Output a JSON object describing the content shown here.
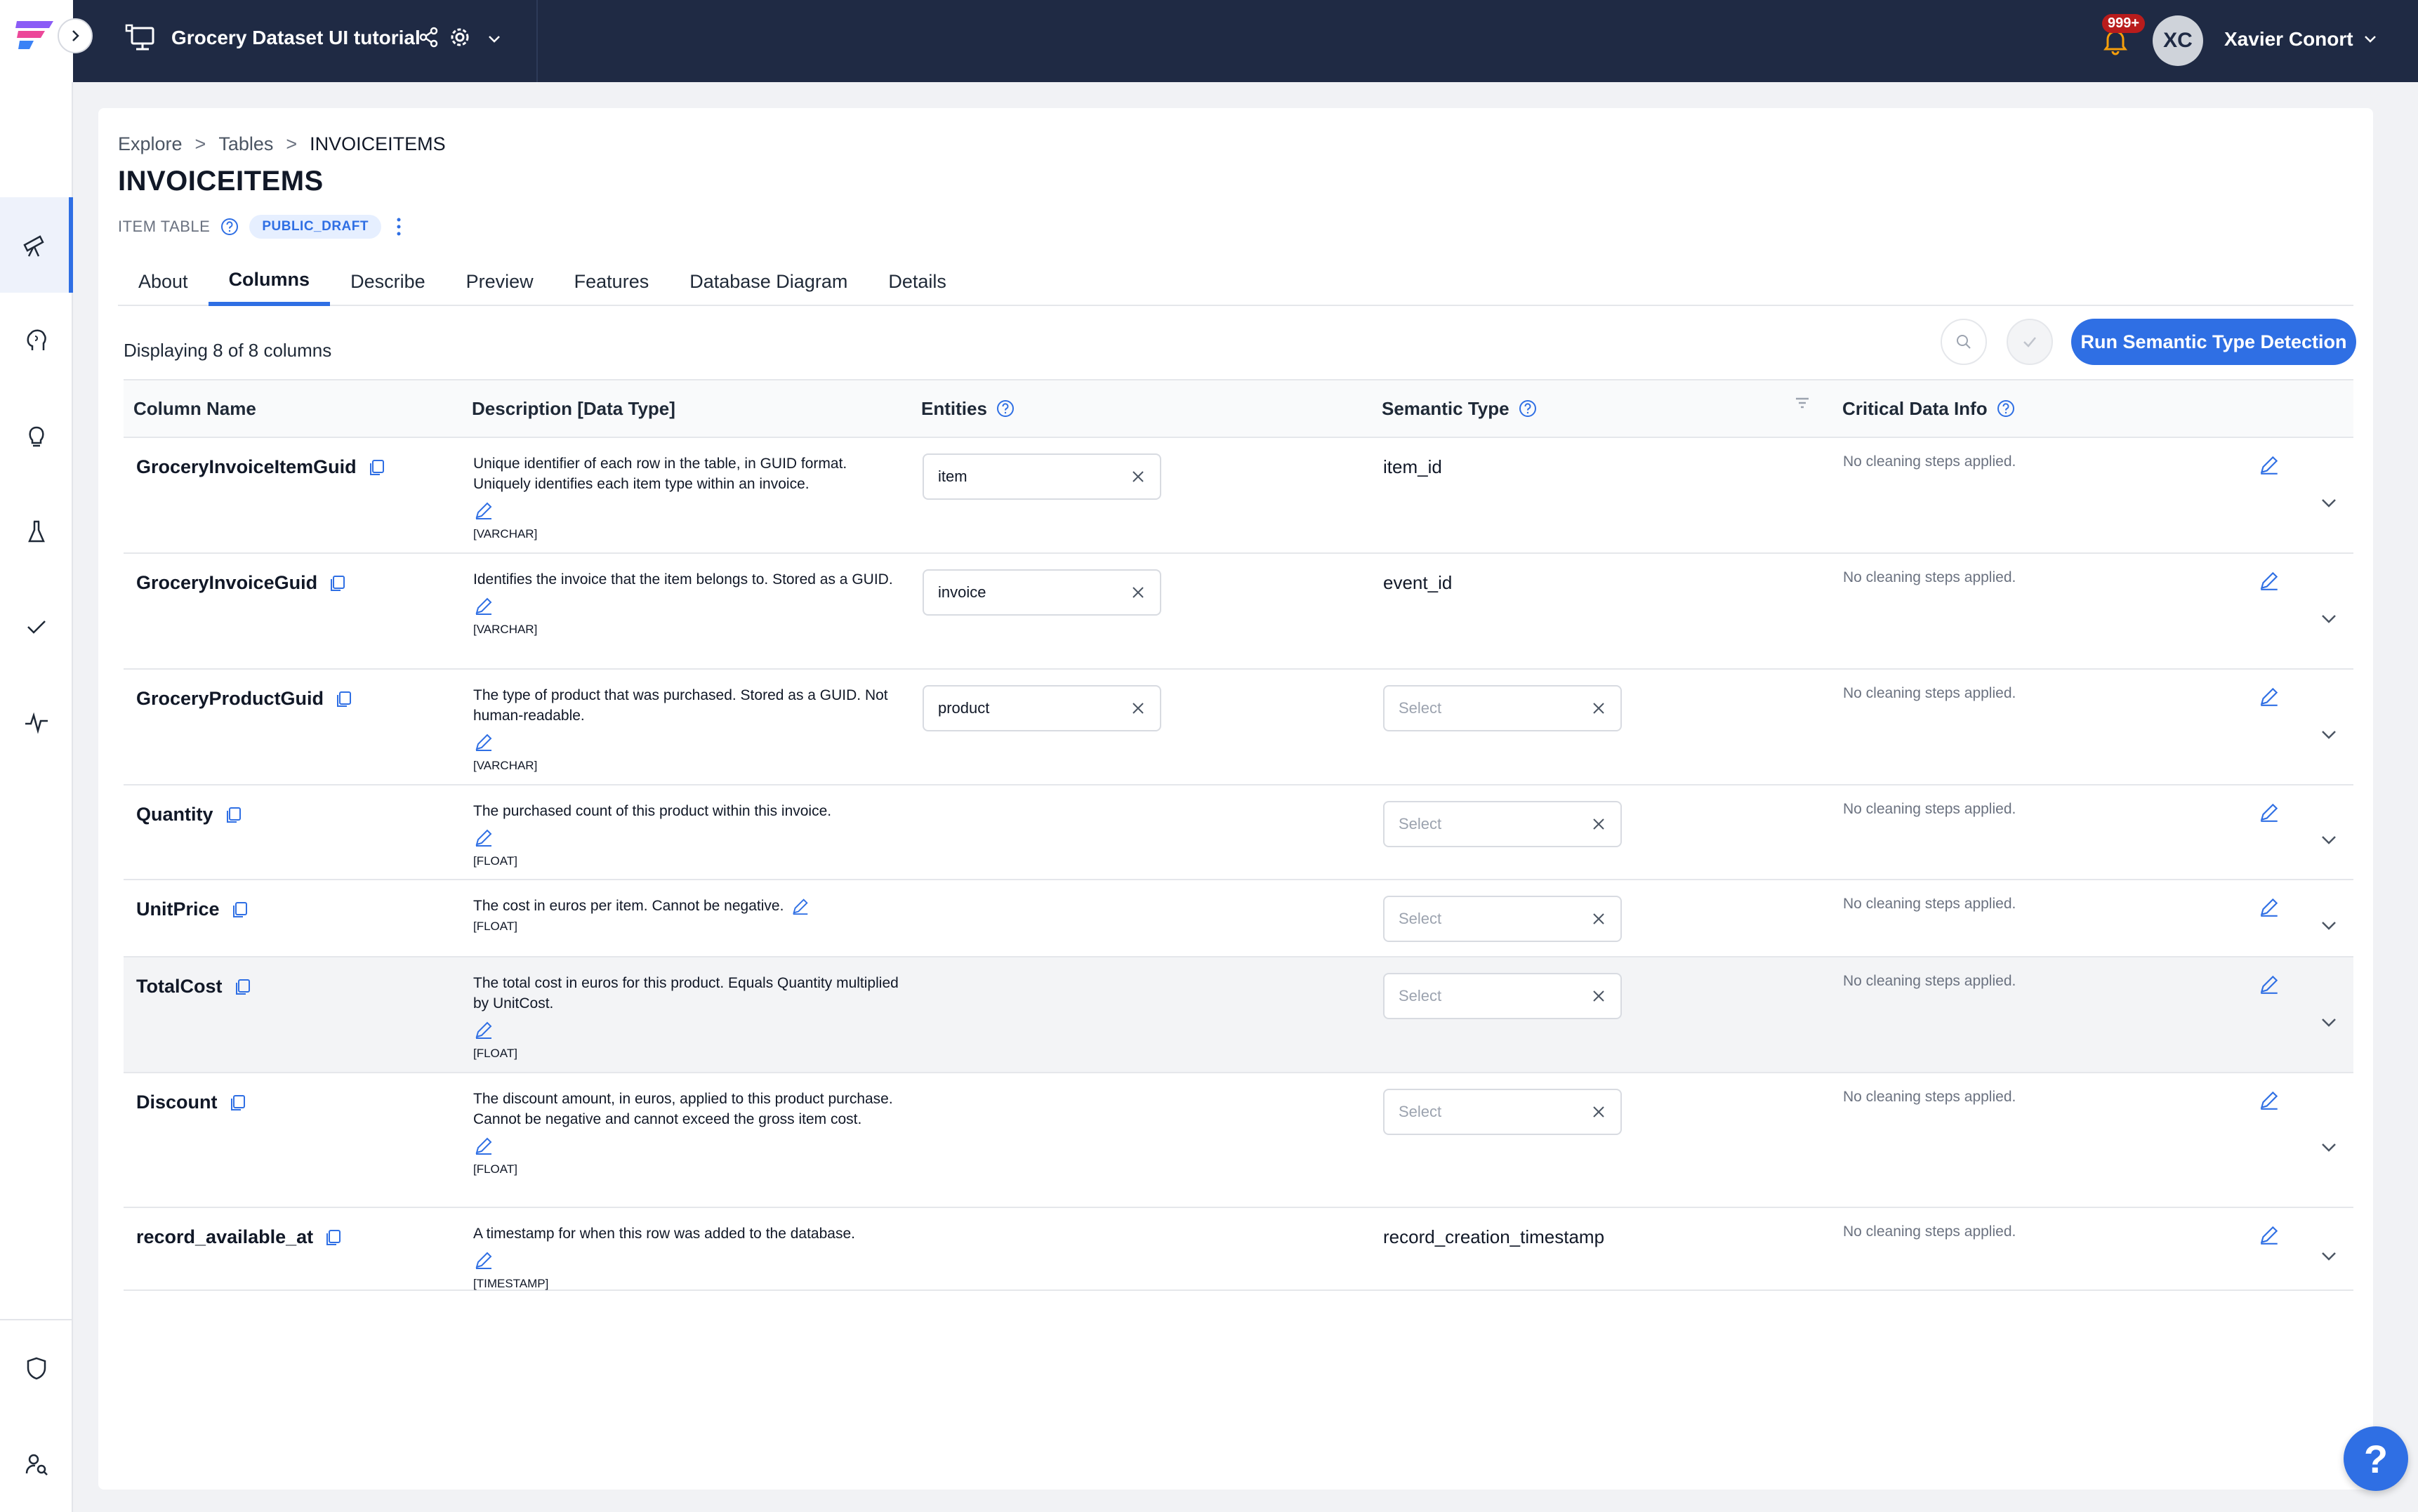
{
  "header": {
    "project_title": "Grocery Dataset UI tutorial",
    "notification_count": "999+",
    "user_initials": "XC",
    "user_name": "Xavier Conort"
  },
  "breadcrumb": [
    "Explore",
    "Tables",
    "INVOICEITEMS"
  ],
  "breadcrumb_sep": ">",
  "page": {
    "title": "INVOICEITEMS",
    "table_type": "ITEM TABLE",
    "status": "PUBLIC_DRAFT"
  },
  "tabs": [
    "About",
    "Columns",
    "Describe",
    "Preview",
    "Features",
    "Database Diagram",
    "Details"
  ],
  "active_tab": "Columns",
  "toolbar": {
    "count_text": "Displaying 8 of 8 columns",
    "run_label": "Run Semantic Type Detection"
  },
  "table": {
    "headers": {
      "column_name": "Column Name",
      "description": "Description [Data Type]",
      "entities": "Entities",
      "semantic_type": "Semantic Type",
      "critical_data_info": "Critical Data Info"
    },
    "select_placeholder": "Select",
    "cleaning_text": "No cleaning steps applied.",
    "rows": [
      {
        "name": "GroceryInvoiceItemGuid",
        "desc": "Unique identifier of each row in the table, in GUID format. Uniquely identifies each item type within an invoice.",
        "dtype": "[VARCHAR]",
        "entity": "item",
        "semantic": "item_id"
      },
      {
        "name": "GroceryInvoiceGuid",
        "desc": "Identifies the invoice that the item belongs to. Stored as a GUID.",
        "dtype": "[VARCHAR]",
        "entity": "invoice",
        "semantic": "event_id"
      },
      {
        "name": "GroceryProductGuid",
        "desc": "The type of product that was purchased. Stored as a GUID. Not human-readable.",
        "dtype": "[VARCHAR]",
        "entity": "product",
        "semantic": ""
      },
      {
        "name": "Quantity",
        "desc": "The purchased count of this product within this invoice.",
        "dtype": "[FLOAT]",
        "entity": "",
        "semantic": ""
      },
      {
        "name": "UnitPrice",
        "desc": "The cost in euros per item. Cannot be negative.",
        "dtype": "[FLOAT]",
        "entity": "",
        "semantic": ""
      },
      {
        "name": "TotalCost",
        "desc": "The total cost in euros for this product. Equals Quantity multiplied by UnitCost.",
        "dtype": "[FLOAT]",
        "entity": "",
        "semantic": ""
      },
      {
        "name": "Discount",
        "desc": "The discount amount, in euros, applied to this product purchase. Cannot be negative and cannot exceed the gross item cost.",
        "dtype": "[FLOAT]",
        "entity": "",
        "semantic": ""
      },
      {
        "name": "record_available_at",
        "desc": "A timestamp for when this row was added to the database.",
        "dtype": "[TIMESTAMP]",
        "entity": "",
        "semantic": "record_creation_timestamp"
      }
    ]
  },
  "help_fab": "?",
  "colors": {
    "accent": "#2f6fe4",
    "topbar": "#1f2a44",
    "badge": "#b91c1c"
  }
}
